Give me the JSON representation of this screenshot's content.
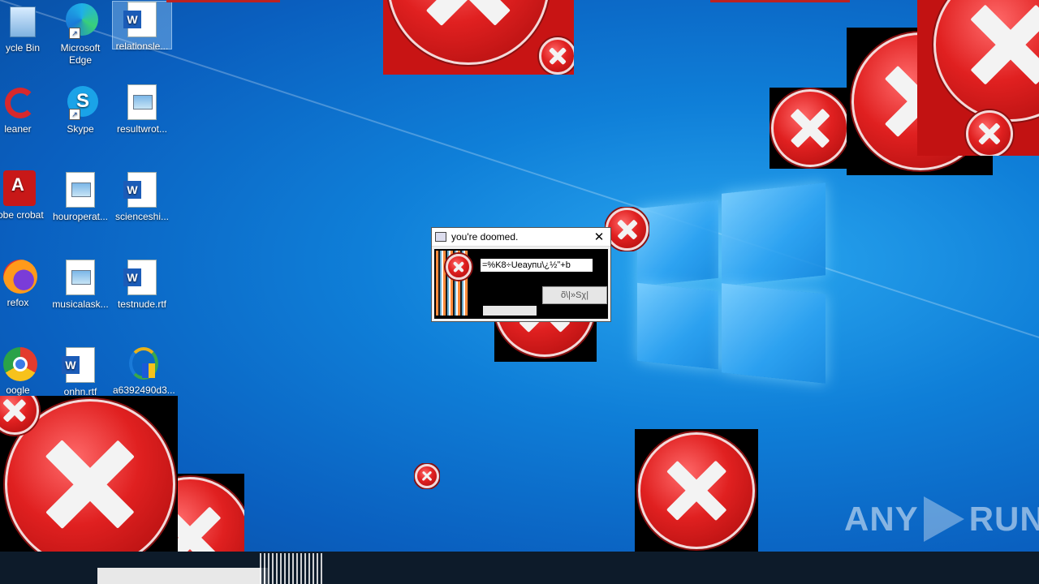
{
  "desktop": {
    "icons": [
      {
        "label": "ycle Bin"
      },
      {
        "label": "Microsoft Edge"
      },
      {
        "label": "relationsle..."
      },
      {
        "label": "leaner"
      },
      {
        "label": "Skype"
      },
      {
        "label": "resultwrot..."
      },
      {
        "label": "dobe crobat"
      },
      {
        "label": "houroperat..."
      },
      {
        "label": "scienceshi..."
      },
      {
        "label": "refox"
      },
      {
        "label": "musicalask..."
      },
      {
        "label": "testnude.rtf"
      },
      {
        "label": "oogle"
      },
      {
        "label": "onhn.rtf"
      },
      {
        "label": "a6392490d3..."
      }
    ]
  },
  "dialog": {
    "title": "you're doomed.",
    "close_glyph": "✕",
    "garbled_text": "=%K8÷Uеayпu\\¿½ʺ+b",
    "garbled_button": "õ\\|»Sχ|"
  },
  "watermark": {
    "text_left": "ANY",
    "text_right": "RUN"
  },
  "colors": {
    "desktop": "#0f7fd8",
    "error_red": "#e02020",
    "taskbar": "#0d1b2a"
  }
}
